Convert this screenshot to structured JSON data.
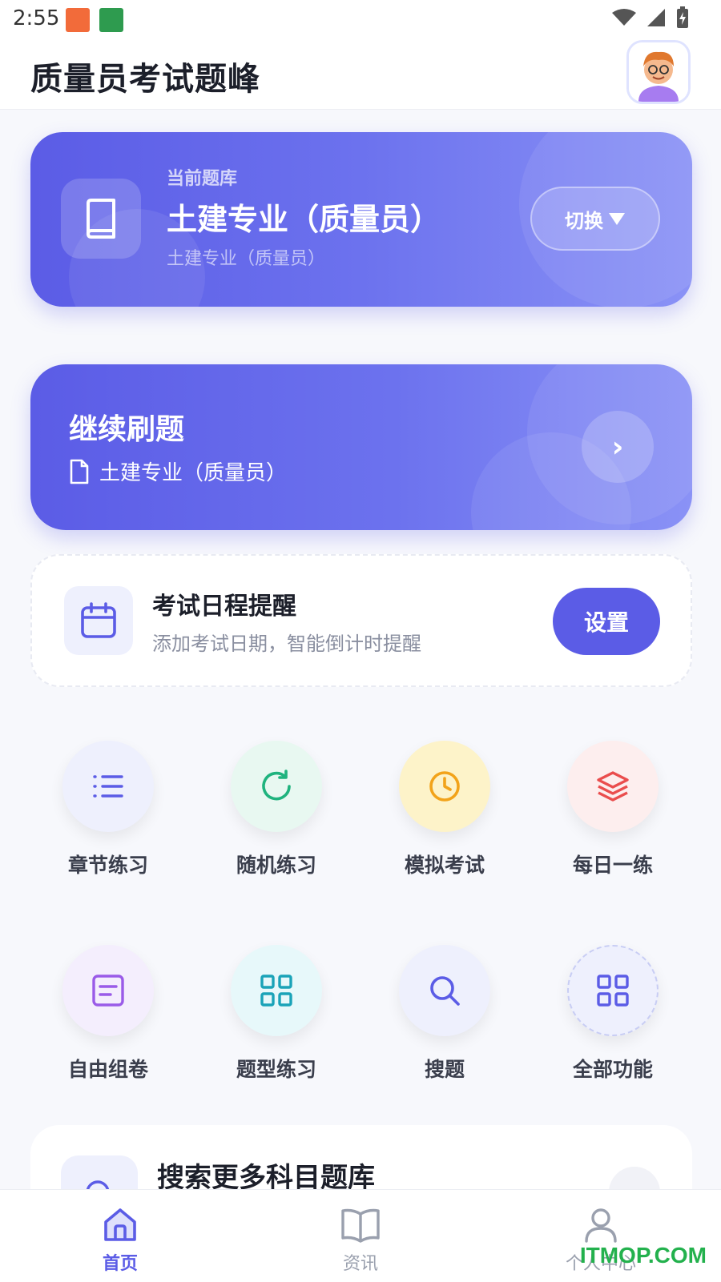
{
  "status_bar": {
    "time": "2:55"
  },
  "header": {
    "title": "质量员考试题峰"
  },
  "question_bank": {
    "label": "当前题库",
    "title": "土建专业（质量员）",
    "subtitle": "土建专业（质量员）",
    "switch_label": "切换"
  },
  "continue_practice": {
    "title": "继续刷题",
    "subtitle": "土建专业（质量员）"
  },
  "reminder": {
    "title": "考试日程提醒",
    "subtitle": "添加考试日期，智能倒计时提醒",
    "button_label": "设置"
  },
  "features": {
    "row1": [
      {
        "label": "章节练习",
        "icon": "list-icon",
        "color": "#5b5ce6",
        "bg": "#eef0fd"
      },
      {
        "label": "随机练习",
        "icon": "refresh-icon",
        "color": "#1fb37e",
        "bg": "#e8f8f1"
      },
      {
        "label": "模拟考试",
        "icon": "clock-icon",
        "color": "#f2a31a",
        "bg": "#fdf3c9"
      },
      {
        "label": "每日一练",
        "icon": "layers-icon",
        "color": "#ea4d4d",
        "bg": "#fdeeee"
      }
    ],
    "row2": [
      {
        "label": "自由组卷",
        "icon": "document-icon",
        "color": "#9a5be8",
        "bg": "#f4eefd"
      },
      {
        "label": "题型练习",
        "icon": "grid-icon",
        "color": "#1aa3b8",
        "bg": "#e7f8fa"
      },
      {
        "label": "搜题",
        "icon": "search-icon",
        "color": "#5b5ce6",
        "bg": "#eef0fd"
      },
      {
        "label": "全部功能",
        "icon": "apps-icon",
        "color": "#5b5ce6",
        "bg": "#eef0fd"
      }
    ]
  },
  "search_more": {
    "title": "搜索更多科目题库"
  },
  "bottom_nav": {
    "items": [
      {
        "label": "首页",
        "icon": "home-icon",
        "active": true
      },
      {
        "label": "资讯",
        "icon": "book-open-icon",
        "active": false
      },
      {
        "label": "个人中心",
        "icon": "user-icon",
        "active": false
      }
    ],
    "active_color": "#5b5ce6",
    "inactive_color": "#9aa0ae"
  },
  "watermark": "ITMOP.COM"
}
